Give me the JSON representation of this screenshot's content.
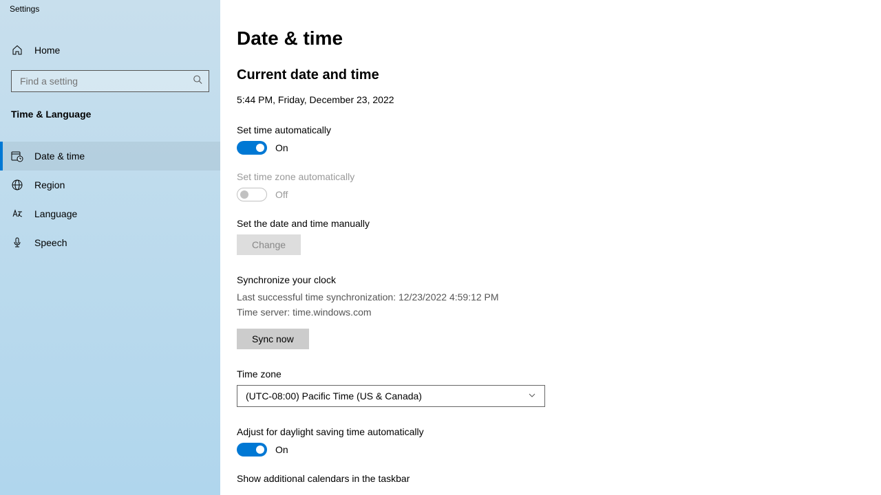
{
  "window": {
    "title": "Settings"
  },
  "sidebar": {
    "home_label": "Home",
    "search_placeholder": "Find a setting",
    "category": "Time & Language",
    "items": [
      {
        "label": "Date & time"
      },
      {
        "label": "Region"
      },
      {
        "label": "Language"
      },
      {
        "label": "Speech"
      }
    ]
  },
  "main": {
    "title": "Date & time",
    "section_current": "Current date and time",
    "current_datetime": "5:44 PM, Friday, December 23, 2022",
    "auto_time": {
      "label": "Set time automatically",
      "state": "On"
    },
    "auto_tz": {
      "label": "Set time zone automatically",
      "state": "Off"
    },
    "manual": {
      "label": "Set the date and time manually",
      "button": "Change"
    },
    "sync": {
      "heading": "Synchronize your clock",
      "last": "Last successful time synchronization: 12/23/2022 4:59:12 PM",
      "server": "Time server: time.windows.com",
      "button": "Sync now"
    },
    "tz": {
      "label": "Time zone",
      "value": "(UTC-08:00) Pacific Time (US & Canada)"
    },
    "dst": {
      "label": "Adjust for daylight saving time automatically",
      "state": "On"
    },
    "calendars": {
      "label": "Show additional calendars in the taskbar"
    }
  }
}
